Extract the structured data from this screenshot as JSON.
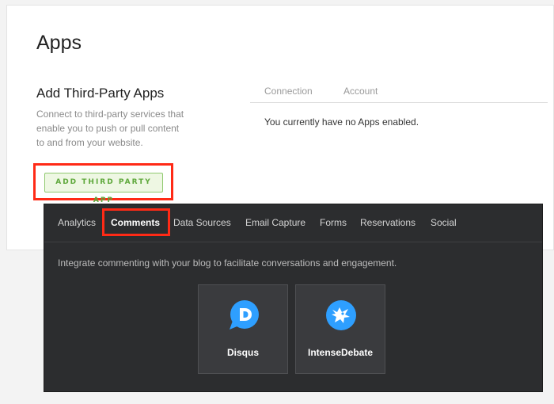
{
  "page": {
    "title": "Apps",
    "section_title": "Add Third-Party Apps",
    "section_description": "Connect to third-party services that enable you to push or pull content to and from your website.",
    "add_button_label": "ADD THIRD PARTY APP"
  },
  "table": {
    "headers": [
      "Connection",
      "Account"
    ],
    "empty_message": "You currently have no Apps enabled."
  },
  "dropdown": {
    "tabs": [
      {
        "label": "Analytics",
        "active": false
      },
      {
        "label": "Comments",
        "active": true
      },
      {
        "label": "Data Sources",
        "active": false
      },
      {
        "label": "Email Capture",
        "active": false
      },
      {
        "label": "Forms",
        "active": false
      },
      {
        "label": "Reservations",
        "active": false
      },
      {
        "label": "Social",
        "active": false
      }
    ],
    "description": "Integrate commenting with your blog to facilitate conversations and engagement.",
    "apps": [
      {
        "name": "Disqus",
        "icon": "disqus-icon"
      },
      {
        "name": "IntenseDebate",
        "icon": "intensedebate-icon"
      }
    ]
  },
  "colors": {
    "highlight": "#ff2a16",
    "button_green": "#5ea83b",
    "dropdown_bg": "#2c2d2f",
    "icon_blue": "#2e9fff"
  }
}
